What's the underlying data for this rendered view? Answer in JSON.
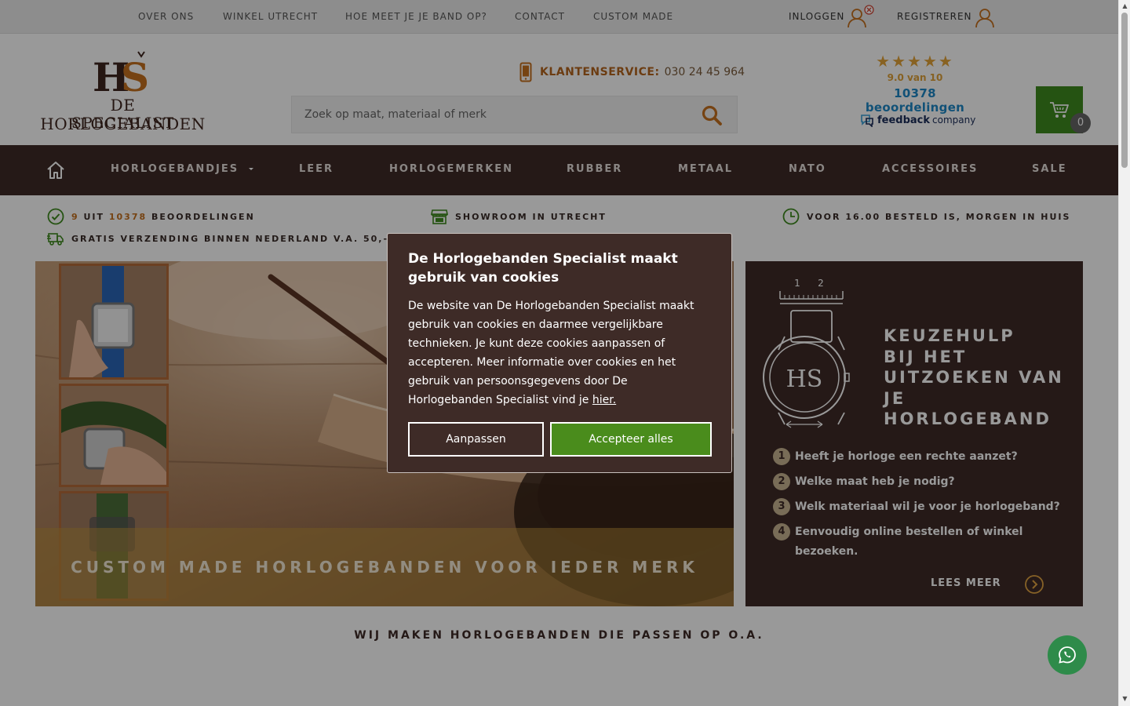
{
  "topbar": {
    "links": [
      {
        "label": "OVER ONS"
      },
      {
        "label": "WINKEL UTRECHT"
      },
      {
        "label": "HOE MEET JE JE BAND OP?"
      },
      {
        "label": "CONTACT"
      },
      {
        "label": "CUSTOM MADE"
      }
    ],
    "login_label": "INLOGGEN",
    "register_label": "REGISTREREN"
  },
  "header": {
    "logo": {
      "monogram": "HS",
      "line1": "DE HORLOGEBANDEN",
      "line2": "SPECIALIST"
    },
    "service_label": "KLANTENSERVICE:",
    "service_phone": "030 24 45 964",
    "search": {
      "placeholder": "Zoek op maat, materiaal of merk"
    },
    "rating": {
      "stars": "★★★★★",
      "value": 4.5,
      "score": "9.0 van 10",
      "count": "10378 beoordelingen"
    },
    "feedback_brand": {
      "a": "feedback",
      "b": "company"
    },
    "cart_count": "0"
  },
  "mainnav": {
    "items": [
      {
        "label": "HORLOGEBANDJES",
        "has_dropdown": true
      },
      {
        "label": "LEER"
      },
      {
        "label": "HORLOGEMERKEN"
      },
      {
        "label": "RUBBER"
      },
      {
        "label": "METAAL"
      },
      {
        "label": "NATO"
      },
      {
        "label": "ACCESSOIRES"
      },
      {
        "label": "SALE"
      }
    ]
  },
  "usps": {
    "reviews": {
      "a": "9",
      "b": "UIT",
      "c": "10378",
      "d": "BEOORDELINGEN"
    },
    "showroom": "SHOWROOM IN UTRECHT",
    "delivery": "VOOR 16.00 BESTELD IS, MORGEN IN HUIS",
    "shipping": "GRATIS VERZENDING BINNEN NEDERLAND V.A. 50,-"
  },
  "hero": {
    "caption": "CUSTOM MADE HORLOGEBANDEN VOOR IEDER MERK"
  },
  "keuzehulp": {
    "ruler_labels": [
      "1",
      "2"
    ],
    "title_lines": [
      "KEUZEHULP",
      "BIJ HET",
      "UITZOEKEN VAN",
      "JE",
      "HORLOGEBAND"
    ],
    "steps": [
      {
        "num": "1",
        "text": "Heeft je horloge een rechte aanzet?"
      },
      {
        "num": "2",
        "text": "Welke maat heb je nodig?"
      },
      {
        "num": "3",
        "text": "Welk materiaal wil je voor je horlogeband?"
      },
      {
        "num": "4",
        "text": "Eenvoudig online bestellen of winkel bezoeken."
      }
    ],
    "more_label": "LEES MEER"
  },
  "brands_heading": "WIJ MAKEN HORLOGEBANDEN DIE PASSEN OP O.A.",
  "cookie": {
    "title": "De Horlogebanden Specialist maakt gebruik van cookies",
    "body": "De website van De Horlogebanden Specialist maakt gebruik van cookies en daarmee vergelijkbare technieken. Je kunt deze cookies aanpassen of accepteren. Meer informatie over cookies en het gebruik van persoonsgegevens door De Horlogebanden Specialist vind je",
    "link_label": "hier.",
    "adjust_label": "Aanpassen",
    "accept_label": "Accepteer alles"
  },
  "colors": {
    "brand_brown": "#3e2b27",
    "accent_orange": "#c5701e",
    "accept_green": "#4a8c1c",
    "cart_green": "#3f8a1e",
    "rating_blue": "#1d88c7",
    "whatsapp_green": "#2e8b4a"
  },
  "icons": {
    "topbar": [
      "user-icon",
      "error-badge-icon"
    ],
    "header": [
      "phone-icon",
      "search-icon",
      "cart-icon"
    ],
    "nav": [
      "home-icon",
      "caret-down-icon"
    ],
    "usp": [
      "check-circle-icon",
      "store-icon",
      "clock-icon",
      "truck-icon"
    ],
    "keuzehulp": [
      "watch-ruler-icon",
      "arrow-circle-right-icon"
    ],
    "floating": [
      "whatsapp-icon"
    ]
  }
}
